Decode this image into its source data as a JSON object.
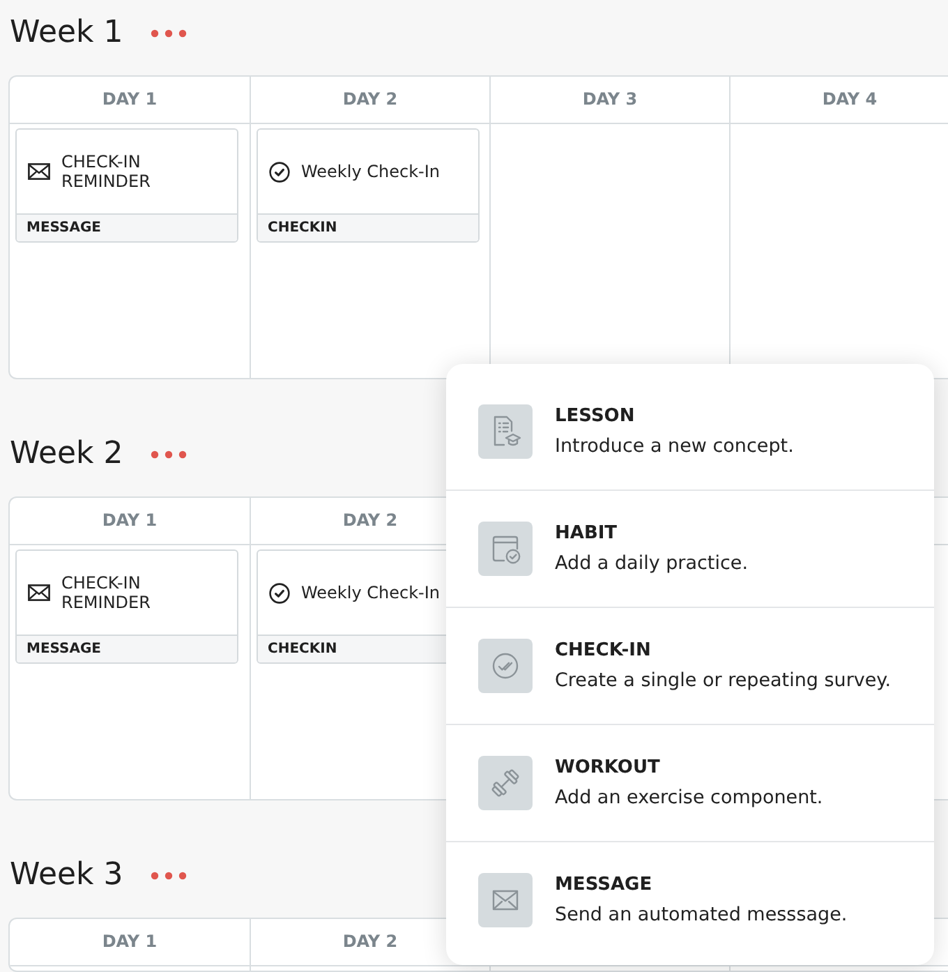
{
  "weeks": [
    {
      "title": "Week 1",
      "days": [
        {
          "label": "DAY 1",
          "items": [
            {
              "kind": "message",
              "title": "CHECK-IN REMINDER",
              "type_label": "MESSAGE"
            }
          ]
        },
        {
          "label": "DAY 2",
          "items": [
            {
              "kind": "checkin",
              "title": "Weekly Check-In",
              "type_label": "CHECKIN"
            }
          ]
        },
        {
          "label": "DAY 3"
        },
        {
          "label": "DAY 4"
        }
      ]
    },
    {
      "title": "Week 2",
      "days": [
        {
          "label": "DAY 1",
          "items": [
            {
              "kind": "message",
              "title": "CHECK-IN REMINDER",
              "type_label": "MESSAGE"
            }
          ]
        },
        {
          "label": "DAY 2",
          "items": [
            {
              "kind": "checkin",
              "title": "Weekly Check-In",
              "type_label": "CHECKIN"
            }
          ]
        }
      ]
    },
    {
      "title": "Week 3",
      "days": [
        {
          "label": "DAY 1"
        },
        {
          "label": "DAY 2"
        }
      ]
    }
  ],
  "add_menu": {
    "items": [
      {
        "kind": "lesson",
        "title": "LESSON",
        "description": "Introduce a new concept."
      },
      {
        "kind": "habit",
        "title": "HABIT",
        "description": "Add a daily practice."
      },
      {
        "kind": "checkin",
        "title": "CHECK-IN",
        "description": "Create a single or repeating survey."
      },
      {
        "kind": "workout",
        "title": "WORKOUT",
        "description": "Add an exercise component."
      },
      {
        "kind": "message",
        "title": "MESSAGE",
        "description": "Send an automated messsage."
      }
    ]
  }
}
